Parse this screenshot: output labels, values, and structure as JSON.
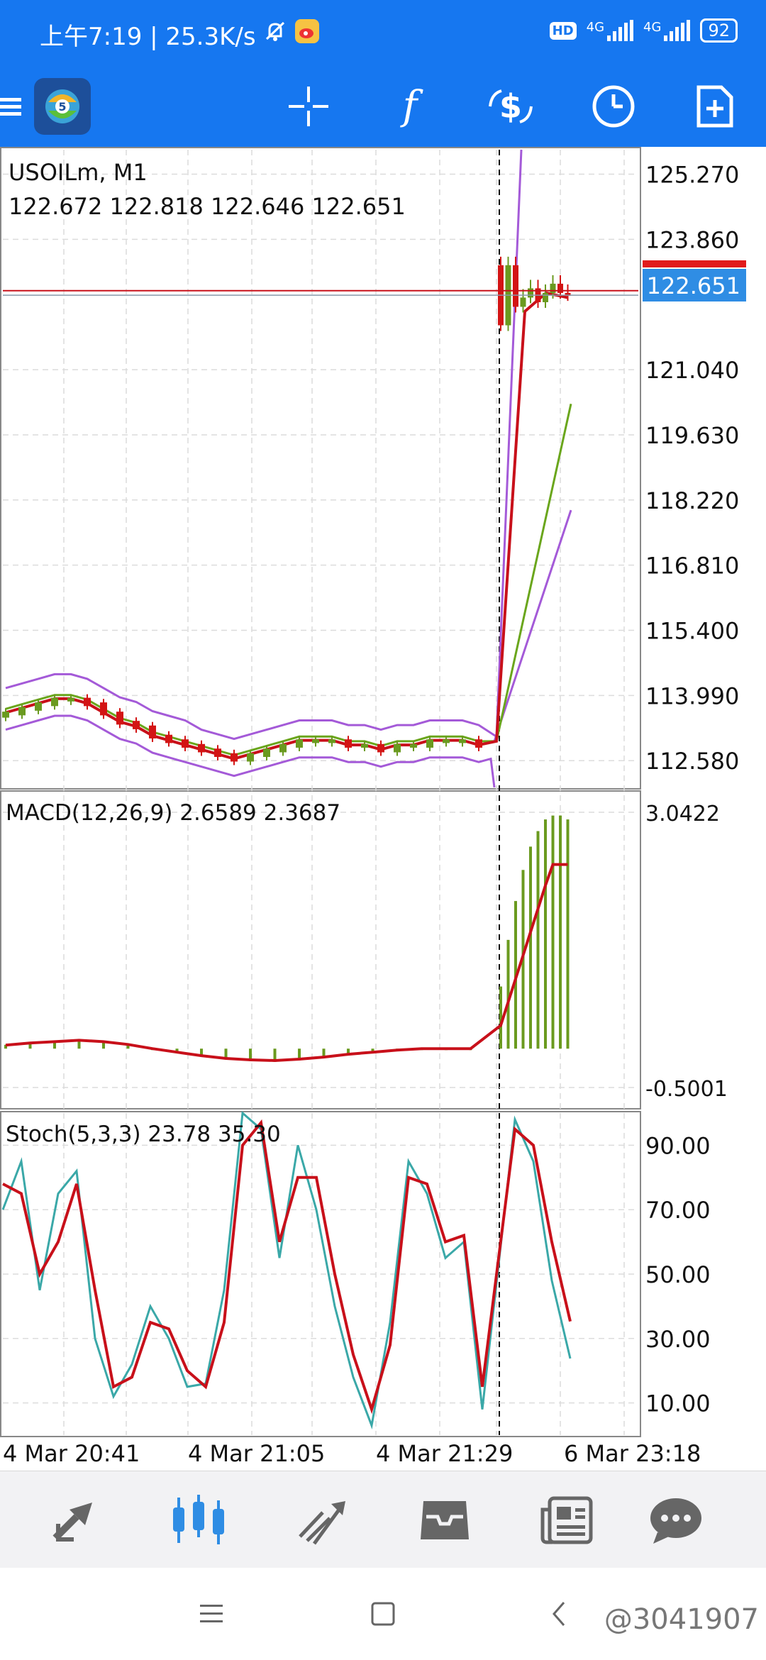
{
  "status_bar": {
    "time_text": "上午7:19 | 25.3K/s",
    "network_labels": [
      "HD",
      "4G",
      "4G"
    ],
    "battery": "92",
    "icons": [
      "bell-off-icon",
      "weibo-icon",
      "signal-icon"
    ]
  },
  "toolbar": {
    "icons": [
      "menu-icon",
      "app-logo",
      "crosshair-icon",
      "indicators-f-icon",
      "trade-dollar-icon",
      "timeframe-clock-icon",
      "new-order-icon"
    ]
  },
  "chart": {
    "symbol": "USOILm, M1",
    "ohlc": "122.672 122.818 122.646 122.651",
    "price_axis": [
      "125.270",
      "123.860",
      "121.040",
      "119.630",
      "118.220",
      "116.810",
      "115.400",
      "113.990",
      "112.580"
    ],
    "current_price": "122.651",
    "macd_label": "MACD(12,26,9) 2.6589 2.3687",
    "macd_axis": [
      "3.0422",
      "-0.5001"
    ],
    "stoch_label": "Stoch(5,3,3) 23.78 35.30",
    "stoch_axis": [
      "90.00",
      "70.00",
      "50.00",
      "30.00",
      "10.00"
    ],
    "time_axis": [
      "4 Mar 20:41",
      "4 Mar 21:05",
      "4 Mar 21:29",
      "6 Mar 23:18"
    ],
    "colors": {
      "bull": "#6a9a1f",
      "bear": "#d31414",
      "ma_fast": "#c8101a",
      "ma_slow": "#6aa61c",
      "bands": "#a45ad8",
      "stoch_main": "#3aa8a8",
      "stoch_signal": "#c8101a",
      "price_tag": "#2f8de4"
    }
  },
  "bottom_nav": {
    "items": [
      "quotes-icon",
      "chart-icon",
      "trade-icon",
      "history-icon",
      "news-icon",
      "messages-icon"
    ],
    "active": "chart-icon"
  },
  "system_nav": {
    "watermark": "@3041907"
  },
  "chart_data": {
    "type": "line",
    "title": "USOILm, M1",
    "price_axis_range": [
      112.0,
      125.8
    ],
    "candles_open_high_low_close_last": [
      122.672,
      122.818,
      122.646,
      122.651
    ],
    "price_before_gap": [
      113.6,
      113.7,
      113.8,
      113.9,
      113.9,
      113.8,
      113.6,
      113.4,
      113.3,
      113.1,
      113.0,
      112.9,
      112.8,
      112.7,
      112.6,
      112.7,
      112.8,
      112.9,
      113.0,
      113.0,
      113.0,
      112.9,
      112.9,
      112.8,
      112.9,
      112.9,
      113.0,
      113.0,
      113.0,
      112.9
    ],
    "price_after_gap": [
      122.0,
      123.3,
      122.4,
      122.6,
      122.8,
      122.5,
      122.7,
      122.9,
      122.7,
      122.651
    ],
    "macd_range": [
      -0.5001,
      3.0422
    ],
    "macd_histogram": [
      0.05,
      0.08,
      0.1,
      0.12,
      0.1,
      0.06,
      0.0,
      -0.05,
      -0.1,
      -0.14,
      -0.16,
      -0.17,
      -0.15,
      -0.12,
      -0.08,
      -0.05,
      -0.02,
      0.0,
      0.0,
      0.0,
      0.8,
      1.4,
      1.9,
      2.3,
      2.6,
      2.8,
      2.95,
      3.0,
      3.0,
      2.95
    ],
    "stoch_range": [
      0,
      100
    ],
    "stoch_main": [
      70,
      85,
      45,
      75,
      82,
      30,
      12,
      22,
      40,
      30,
      15,
      16,
      45,
      100,
      95,
      55,
      90,
      70,
      40,
      18,
      3,
      35,
      85,
      75,
      55,
      60,
      8,
      98,
      85,
      48,
      23.78
    ],
    "stoch_signal": [
      78,
      75,
      50,
      60,
      78,
      45,
      15,
      18,
      35,
      33,
      20,
      15,
      35,
      90,
      97,
      60,
      80,
      80,
      50,
      25,
      8,
      28,
      80,
      78,
      60,
      62,
      15,
      95,
      90,
      60,
      35.3
    ]
  }
}
